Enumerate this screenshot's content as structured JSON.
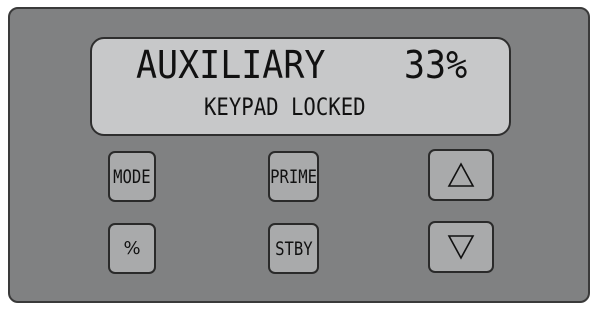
{
  "display": {
    "mode_text": "AUXILIARY",
    "percent_text": "33%",
    "status_text": "KEYPAD LOCKED"
  },
  "keys": {
    "mode_label": "MODE",
    "percent_label": "%",
    "prime_label": "PRIME",
    "stby_label": "STBY",
    "up_icon": "triangle-up-icon",
    "down_icon": "triangle-down-icon"
  },
  "colors": {
    "panel": "#808182",
    "lcd": "#c7c8c9",
    "key": "#a9aaab"
  }
}
